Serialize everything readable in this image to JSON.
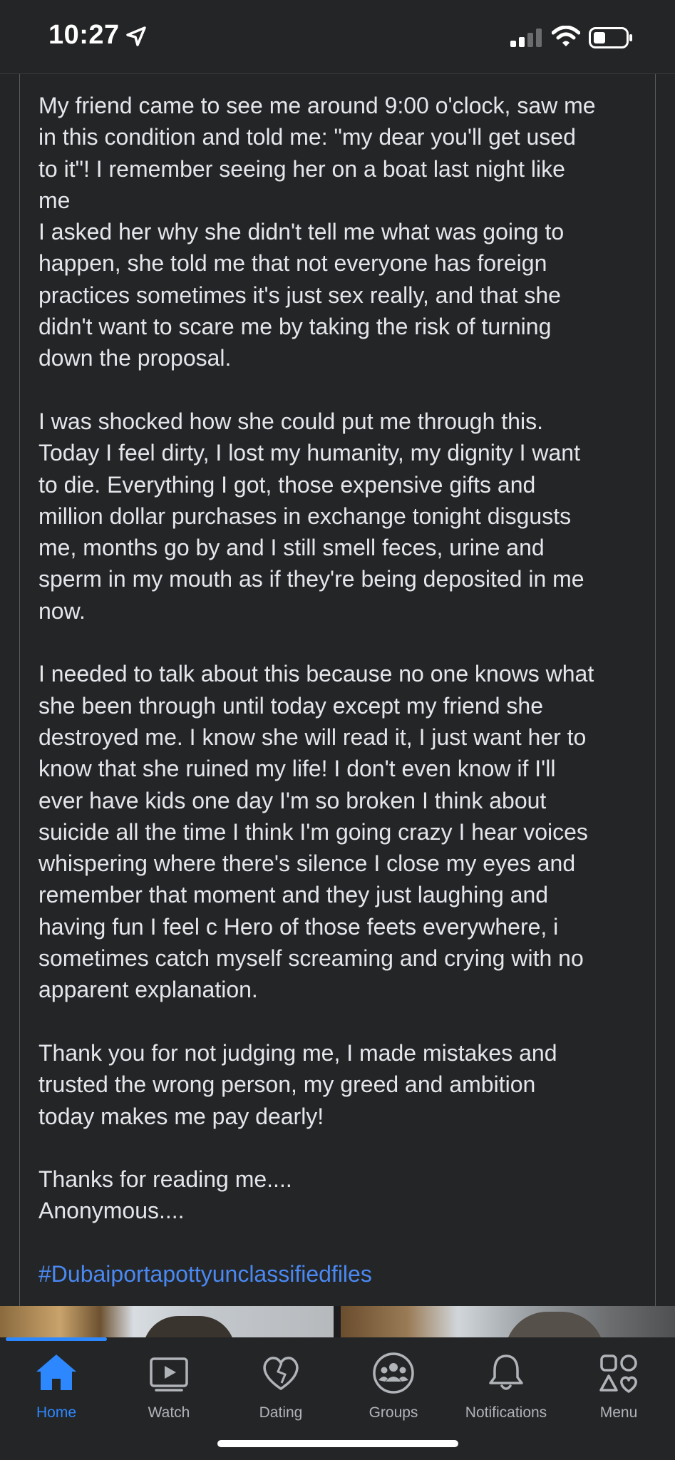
{
  "status_bar": {
    "time": "10:27"
  },
  "post": {
    "paragraphs": [
      "My friend came to see me around 9:00 o'clock, saw me\nin this condition and told me: \"my dear you'll get used\nto it\"! I remember seeing her on a boat last night like\nme\nI asked her why she didn't tell me what was going to\nhappen, she told me that not everyone has foreign\npractices sometimes it's just sex really, and that she\ndidn't want to scare me by taking the risk of turning\ndown the proposal.",
      "I was shocked how she could put me through this.\nToday I feel dirty, I lost my humanity, my dignity I want\nto die. Everything I got, those expensive gifts and\nmillion dollar purchases in exchange tonight disgusts\nme, months go by and I still smell feces, urine and\nsperm in my mouth as if they're being deposited in me\nnow.",
      "I needed to talk about this because no one knows what\nshe been through until today except my friend she\ndestroyed me. I know she will read it, I just want her to\nknow that she ruined my life! I don't even know if I'll\never have kids one day I'm so broken I think about\nsuicide all the time I think I'm going crazy I hear voices\nwhispering where there's silence I close my eyes and\nremember that moment and they just laughing and\nhaving fun I feel c Hero of those feets everywhere, i\nsometimes catch myself screaming and crying with no\napparent explanation.",
      "Thank you for not judging me, I made mistakes and\ntrusted the wrong person, my greed and ambition\ntoday makes me pay dearly!",
      "Thanks for reading me....\nAnonymous...."
    ],
    "hashtag": "#Dubaiportapottyunclassifiedfiles"
  },
  "tab_bar": {
    "tabs": [
      {
        "label": "Home",
        "icon": "home-icon",
        "active": true
      },
      {
        "label": "Watch",
        "icon": "watch-icon",
        "active": false
      },
      {
        "label": "Dating",
        "icon": "dating-icon",
        "active": false
      },
      {
        "label": "Groups",
        "icon": "groups-icon",
        "active": false
      },
      {
        "label": "Notifications",
        "icon": "bell-icon",
        "active": false
      },
      {
        "label": "Menu",
        "icon": "menu-icon",
        "active": false
      }
    ]
  },
  "colors": {
    "background": "#242526",
    "text": "#e4e6eb",
    "accent": "#2d88ff",
    "hashtag": "#4a89f3",
    "inactive_icon": "#b0b3b8"
  }
}
